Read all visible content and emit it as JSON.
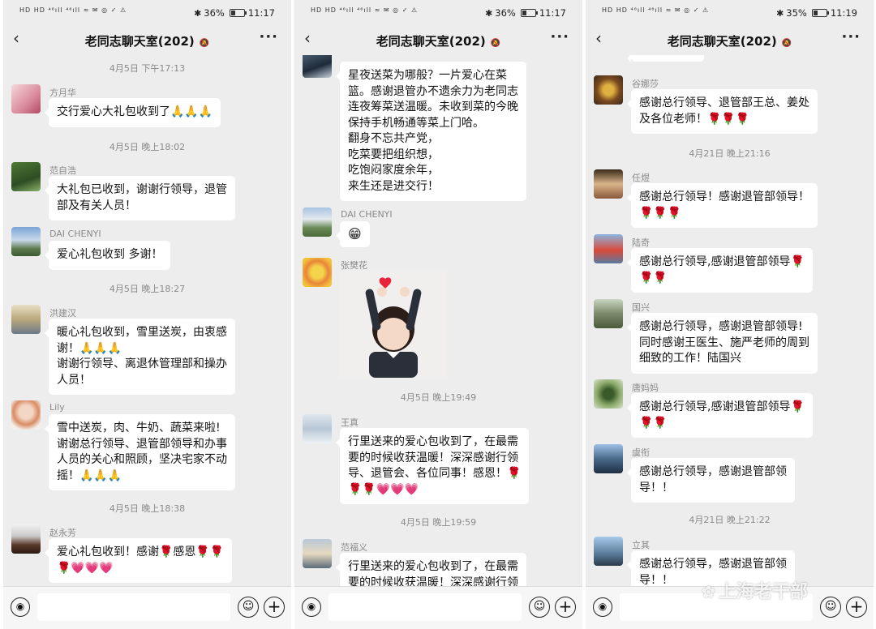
{
  "chat_title": "老同志聊天室(202)",
  "icons": {
    "back": "chevron-left-icon",
    "mute": "bell-off-icon",
    "more": "more-dots-icon",
    "voice": "voice-icon",
    "emoji": "emoji-icon",
    "plus": "plus-icon"
  },
  "glyphs": {
    "back": "‹",
    "bell": "🔕",
    "more": "···",
    "voice": "◉",
    "emoji": "☺",
    "plus": "+",
    "bt": "✱"
  },
  "colors": {
    "bg": "#ededed",
    "bubble": "#ffffff",
    "meta": "#8a8a8a"
  },
  "watermark": {
    "icon": "✿",
    "text": "上海老干部"
  },
  "screens": [
    {
      "status": {
        "left": "HD HD ⁴⁶ıll ⁴⁶ıll ≈ ✉ ◎ ✓ ⚠",
        "battery_pct": "36%",
        "battery_level": 0.36,
        "time": "11:17"
      },
      "messages": [
        {
          "type": "time",
          "text": "4月5日 下午17:13"
        },
        {
          "type": "msg",
          "sender": "方月华",
          "text": "交行爱心大礼包收到了🙏🙏🙏"
        },
        {
          "type": "time",
          "text": "4月5日 晚上18:02"
        },
        {
          "type": "msg",
          "sender": "范自浩",
          "text": "大礼包已收到，谢谢行领导，退管\n部及有关人员！"
        },
        {
          "type": "msg",
          "sender": "DAI CHENYI",
          "text": "爱心礼包收到 多谢！"
        },
        {
          "type": "time",
          "text": "4月5日 晚上18:27"
        },
        {
          "type": "msg",
          "sender": "洪建汉",
          "text": "暖心礼包收到，雪里送炭，由衷感\n谢！🙏🙏🙏\n谢谢行领导、离退休管理部和操办\n人员！"
        },
        {
          "type": "msg",
          "sender": "Lily",
          "text": "雪中送炭，肉、牛奶、蔬菜来啦!\n谢谢总行领导、退管部领导和办事\n人员的关心和照顾，坚决宅家不动\n摇！🙏🙏🙏"
        },
        {
          "type": "time",
          "text": "4月5日 晚上18:38"
        },
        {
          "type": "msg",
          "sender": "赵永芳",
          "text": "爱心礼包收到！感谢🌹感恩🌹🌹\n🌹💗💗💗"
        }
      ]
    },
    {
      "status": {
        "left": "HD HD ⁴⁶ıll ⁴⁶ıll ≈ ✉ ◎ ✓ ⚠",
        "battery_pct": "36%",
        "battery_level": 0.36,
        "time": "11:17"
      },
      "messages": [
        {
          "type": "msg",
          "sender": "",
          "text": "星夜送菜为哪般？一片爱心在菜\n篮。感谢退管办不遗余力为老同志\n连夜筹菜送温暖。未收到菜的今晚\n保持手机畅通等菜上门哈。\n翻身不忘共产党，\n吃菜要把组织想，\n吃饱闷家度余年，\n来生还是进交行！"
        },
        {
          "type": "msg",
          "sender": "DAI CHENYI",
          "text": "😁"
        },
        {
          "type": "photo",
          "sender": "张樊花"
        },
        {
          "type": "time",
          "text": "4月5日 晚上19:49"
        },
        {
          "type": "msg",
          "sender": "王真",
          "text": "行里送来的爱心包收到了，在最需\n要的时候收获温暖！深深感谢行领\n导、退管会、各位同事！感恩！🌹\n🌹🌹💗💗💗"
        },
        {
          "type": "time",
          "text": "4月5日 晚上19:59"
        },
        {
          "type": "msg",
          "sender": "范福义",
          "text": "行里送来的爱心包收到了，在最需\n要的时候收获温暖！深深感谢行领"
        }
      ]
    },
    {
      "status": {
        "left": "HD HD ⁴⁶ıll ⁴⁶ıll ≈ ✉ ◎ ✓ ⚠",
        "battery_pct": "35%",
        "battery_level": 0.35,
        "time": "11:19"
      },
      "messages": [
        {
          "type": "msg",
          "sender": "谷娜莎",
          "text": "感谢总行领导、退管部王总、姜处\n及各位老师！🌹🌹🌹"
        },
        {
          "type": "time",
          "text": "4月21日 晚上21:16"
        },
        {
          "type": "msg",
          "sender": "任煜",
          "text": "感谢总行领导！感谢退管部领导！\n🌹🌹🌹"
        },
        {
          "type": "msg",
          "sender": "陆奇",
          "text": "感谢总行领导,感谢退管部领导🌹\n🌹🌹"
        },
        {
          "type": "msg",
          "sender": "国兴",
          "text": "感谢总行领导，感谢退管部领导!\n同时感谢王医生、施严老师的周到\n细致的工作！陆国兴"
        },
        {
          "type": "msg",
          "sender": "唐妈妈",
          "text": "感谢总行领导,感谢退管部领导🌹\n🌹🌹"
        },
        {
          "type": "msg",
          "sender": "虞衔",
          "text": "感谢总行领导，感谢退管部领\n导！！"
        },
        {
          "type": "time",
          "text": "4月21日 晚上21:22"
        },
        {
          "type": "msg",
          "sender": "立其",
          "text": "感谢总行领导，感谢退管部领\n导！！"
        }
      ]
    }
  ]
}
